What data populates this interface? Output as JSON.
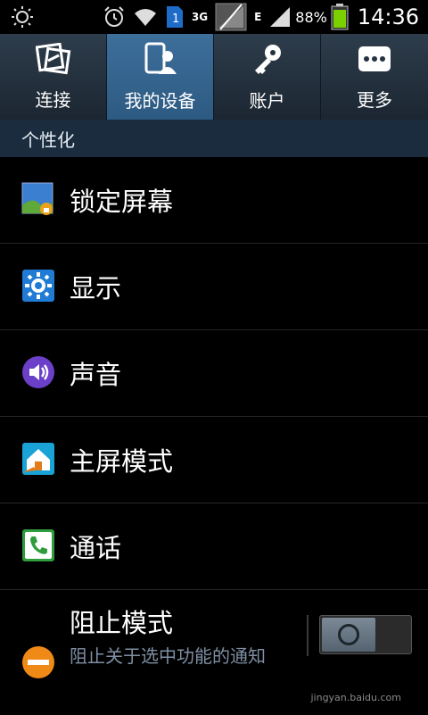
{
  "status": {
    "network_1": "3G",
    "network_2": "E",
    "sim": "1",
    "battery": "88%",
    "time": "14:36"
  },
  "tabs": [
    {
      "label": "连接",
      "icon": "connections-icon"
    },
    {
      "label": "我的设备",
      "icon": "my-device-icon"
    },
    {
      "label": "账户",
      "icon": "accounts-icon"
    },
    {
      "label": "更多",
      "icon": "more-icon"
    }
  ],
  "section": {
    "title": "个性化"
  },
  "items": [
    {
      "title": "锁定屏幕",
      "icon": "lock-screen-icon"
    },
    {
      "title": "显示",
      "icon": "display-icon"
    },
    {
      "title": "声音",
      "icon": "sound-icon"
    },
    {
      "title": "主屏模式",
      "icon": "home-screen-mode-icon"
    },
    {
      "title": "通话",
      "icon": "call-icon"
    },
    {
      "title": "阻止模式",
      "subtitle": "阻止关于选中功能的通知",
      "icon": "blocking-mode-icon",
      "toggle": "off"
    }
  ],
  "watermark": "jingyan.baidu.com",
  "colors": {
    "tab_active": "#3d6f9b",
    "section_bg": "#1a2c3d",
    "subtitle": "#7e8fa3",
    "battery_green": "#7bd000"
  }
}
